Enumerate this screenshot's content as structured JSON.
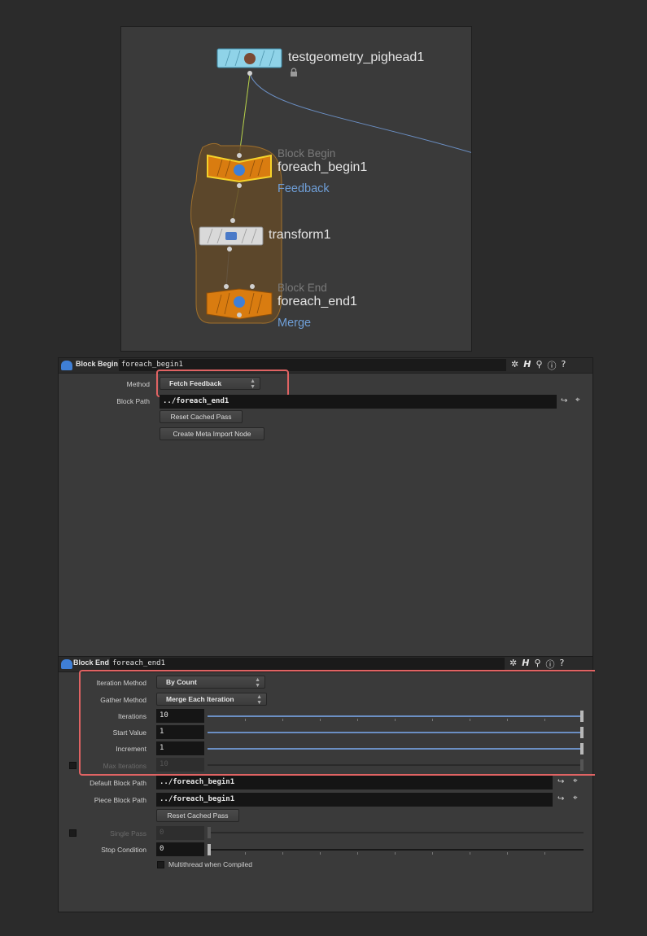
{
  "network": {
    "nodes": {
      "testgeometry": {
        "name": "testgeometry_pighead1"
      },
      "foreach_begin": {
        "type": "Block Begin",
        "name": "foreach_begin1",
        "mode": "Feedback"
      },
      "transform": {
        "name": "transform1"
      },
      "foreach_end": {
        "type": "Block End",
        "name": "foreach_end1",
        "mode": "Merge"
      }
    },
    "colors": {
      "network_bg": "#3a3a3a",
      "loop_box": "#634a29",
      "loop_node": "#d97c10",
      "geo_node": "#8fd3e8",
      "selected": "#f5d22a",
      "wire_blue": "#6b8fc4"
    }
  },
  "block_begin_panel": {
    "type_label": "Block Begin",
    "node_name": "foreach_begin1",
    "params": {
      "method": {
        "label": "Method",
        "value": "Fetch Feedback"
      },
      "block_path": {
        "label": "Block Path",
        "value": "../foreach_end1"
      },
      "reset_cached_pass": "Reset Cached Pass",
      "create_meta_import": "Create Meta Import Node"
    }
  },
  "block_end_panel": {
    "type_label": "Block End",
    "node_name": "foreach_end1",
    "params": {
      "iteration_method": {
        "label": "Iteration Method",
        "value": "By Count"
      },
      "gather_method": {
        "label": "Gather Method",
        "value": "Merge Each Iteration"
      },
      "iterations": {
        "label": "Iterations",
        "value": "10"
      },
      "start_value": {
        "label": "Start Value",
        "value": "1"
      },
      "increment": {
        "label": "Increment",
        "value": "1"
      },
      "max_iterations": {
        "label": "Max Iterations",
        "value": "10"
      },
      "default_block_path": {
        "label": "Default Block Path",
        "value": "../foreach_begin1"
      },
      "piece_block_path": {
        "label": "Piece Block Path",
        "value": "../foreach_begin1"
      },
      "reset_cached_pass": "Reset Cached Pass",
      "single_pass": {
        "label": "Single Pass",
        "value": "0"
      },
      "stop_condition": {
        "label": "Stop Condition",
        "value": "0"
      },
      "multithread": {
        "label": "Multithread when Compiled"
      }
    }
  },
  "icons": [
    "gear-icon",
    "help-h-icon",
    "search-icon",
    "info-icon",
    "question-icon",
    "channel-jump-icon",
    "node-chooser-icon"
  ],
  "highlight_color": "#e06363"
}
